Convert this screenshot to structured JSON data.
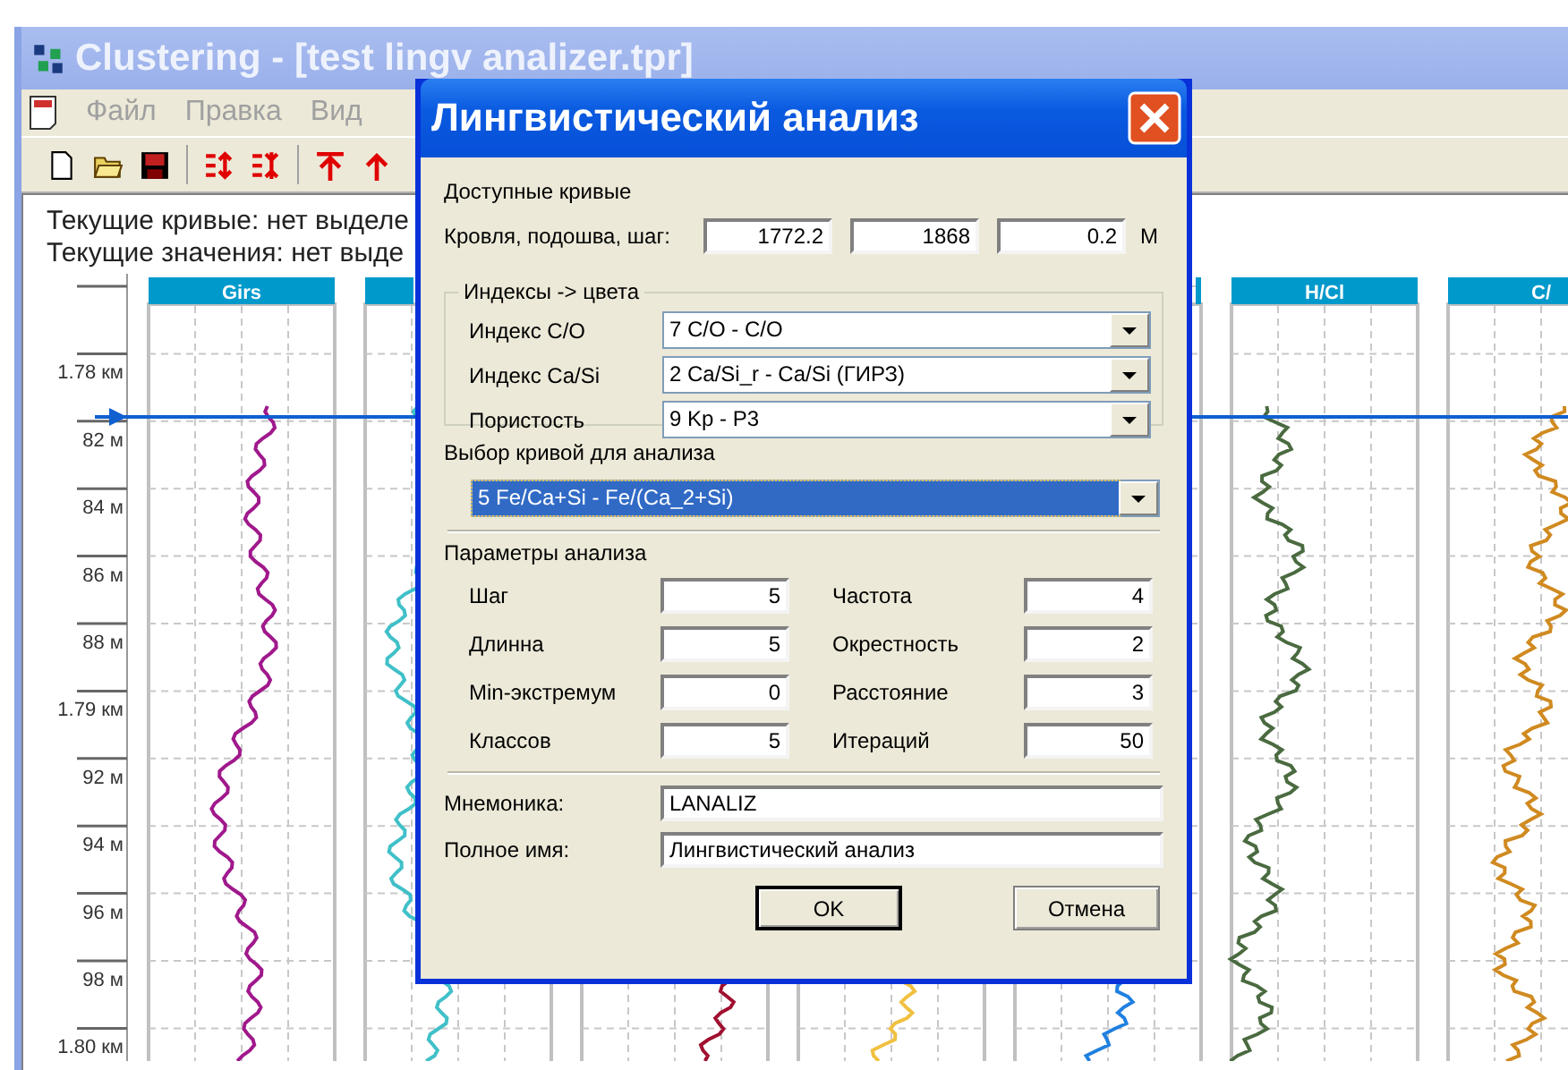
{
  "window": {
    "title": "Clustering - [test lingv analizer.tpr]"
  },
  "menu": [
    {
      "label": "Файл"
    },
    {
      "label": "Правка"
    },
    {
      "label": "Вид"
    }
  ],
  "status_lines": [
    "Текущие кривые: нет выделе",
    "Текущие значения: нет выде"
  ],
  "depth_labels": [
    "1.78 км",
    "82 м",
    "84 м",
    "86 м",
    "88 м",
    "1.79 км",
    "92 м",
    "94 м",
    "96 м",
    "98 м",
    "1.80 км"
  ],
  "tracks": [
    {
      "title": "Girs",
      "color": "#a0188c"
    },
    {
      "color": "#40c0c8"
    },
    {
      "color": "#a01030"
    },
    {
      "color": "#f0c040"
    },
    {
      "color": "#2080e0"
    },
    {
      "title": "H/Cl",
      "color": "#4a6a40"
    },
    {
      "title": "C/",
      "color": "#d08a20"
    }
  ],
  "dialog": {
    "title": "Лингвистический анализ",
    "available_label": "Доступные кривые",
    "range_label": "Кровля, подошва, шаг:",
    "range_values": [
      "1772.2",
      "1868",
      "0.2"
    ],
    "range_unit": "М",
    "group_title": "Индексы -> цвета",
    "index_rows": [
      {
        "label": "Индекс C/O",
        "value": "7 C/O - C/O"
      },
      {
        "label": "Индекс Ca/Si",
        "value": "2 Ca/Si_r - Ca/Si (ГИРЗ)"
      },
      {
        "label": "Пористость",
        "value": "9 Kp - P3"
      }
    ],
    "curve_label": "Выбор кривой для анализа",
    "curve_value": "5 Fe/Ca+Si - Fe/(Ca_2+Si)",
    "params_title": "Параметры анализа",
    "params_left": [
      {
        "label": "Шаг",
        "value": "5"
      },
      {
        "label": "Длинна",
        "value": "5"
      },
      {
        "label": "Min-экстремум",
        "value": "0"
      },
      {
        "label": "Классов",
        "value": "5"
      }
    ],
    "params_right": [
      {
        "label": "Частота",
        "value": "4"
      },
      {
        "label": "Окрестность",
        "value": "2"
      },
      {
        "label": "Расстояние",
        "value": "3"
      },
      {
        "label": "Итераций",
        "value": "50"
      }
    ],
    "name_rows": [
      {
        "label": "Мнемоника:",
        "value": "LANALIZ"
      },
      {
        "label": "Полное имя:",
        "value": "Лингвистический анализ"
      }
    ],
    "buttons": [
      {
        "label": "OK",
        "default": true
      },
      {
        "label": "Отмена",
        "default": false
      }
    ]
  }
}
